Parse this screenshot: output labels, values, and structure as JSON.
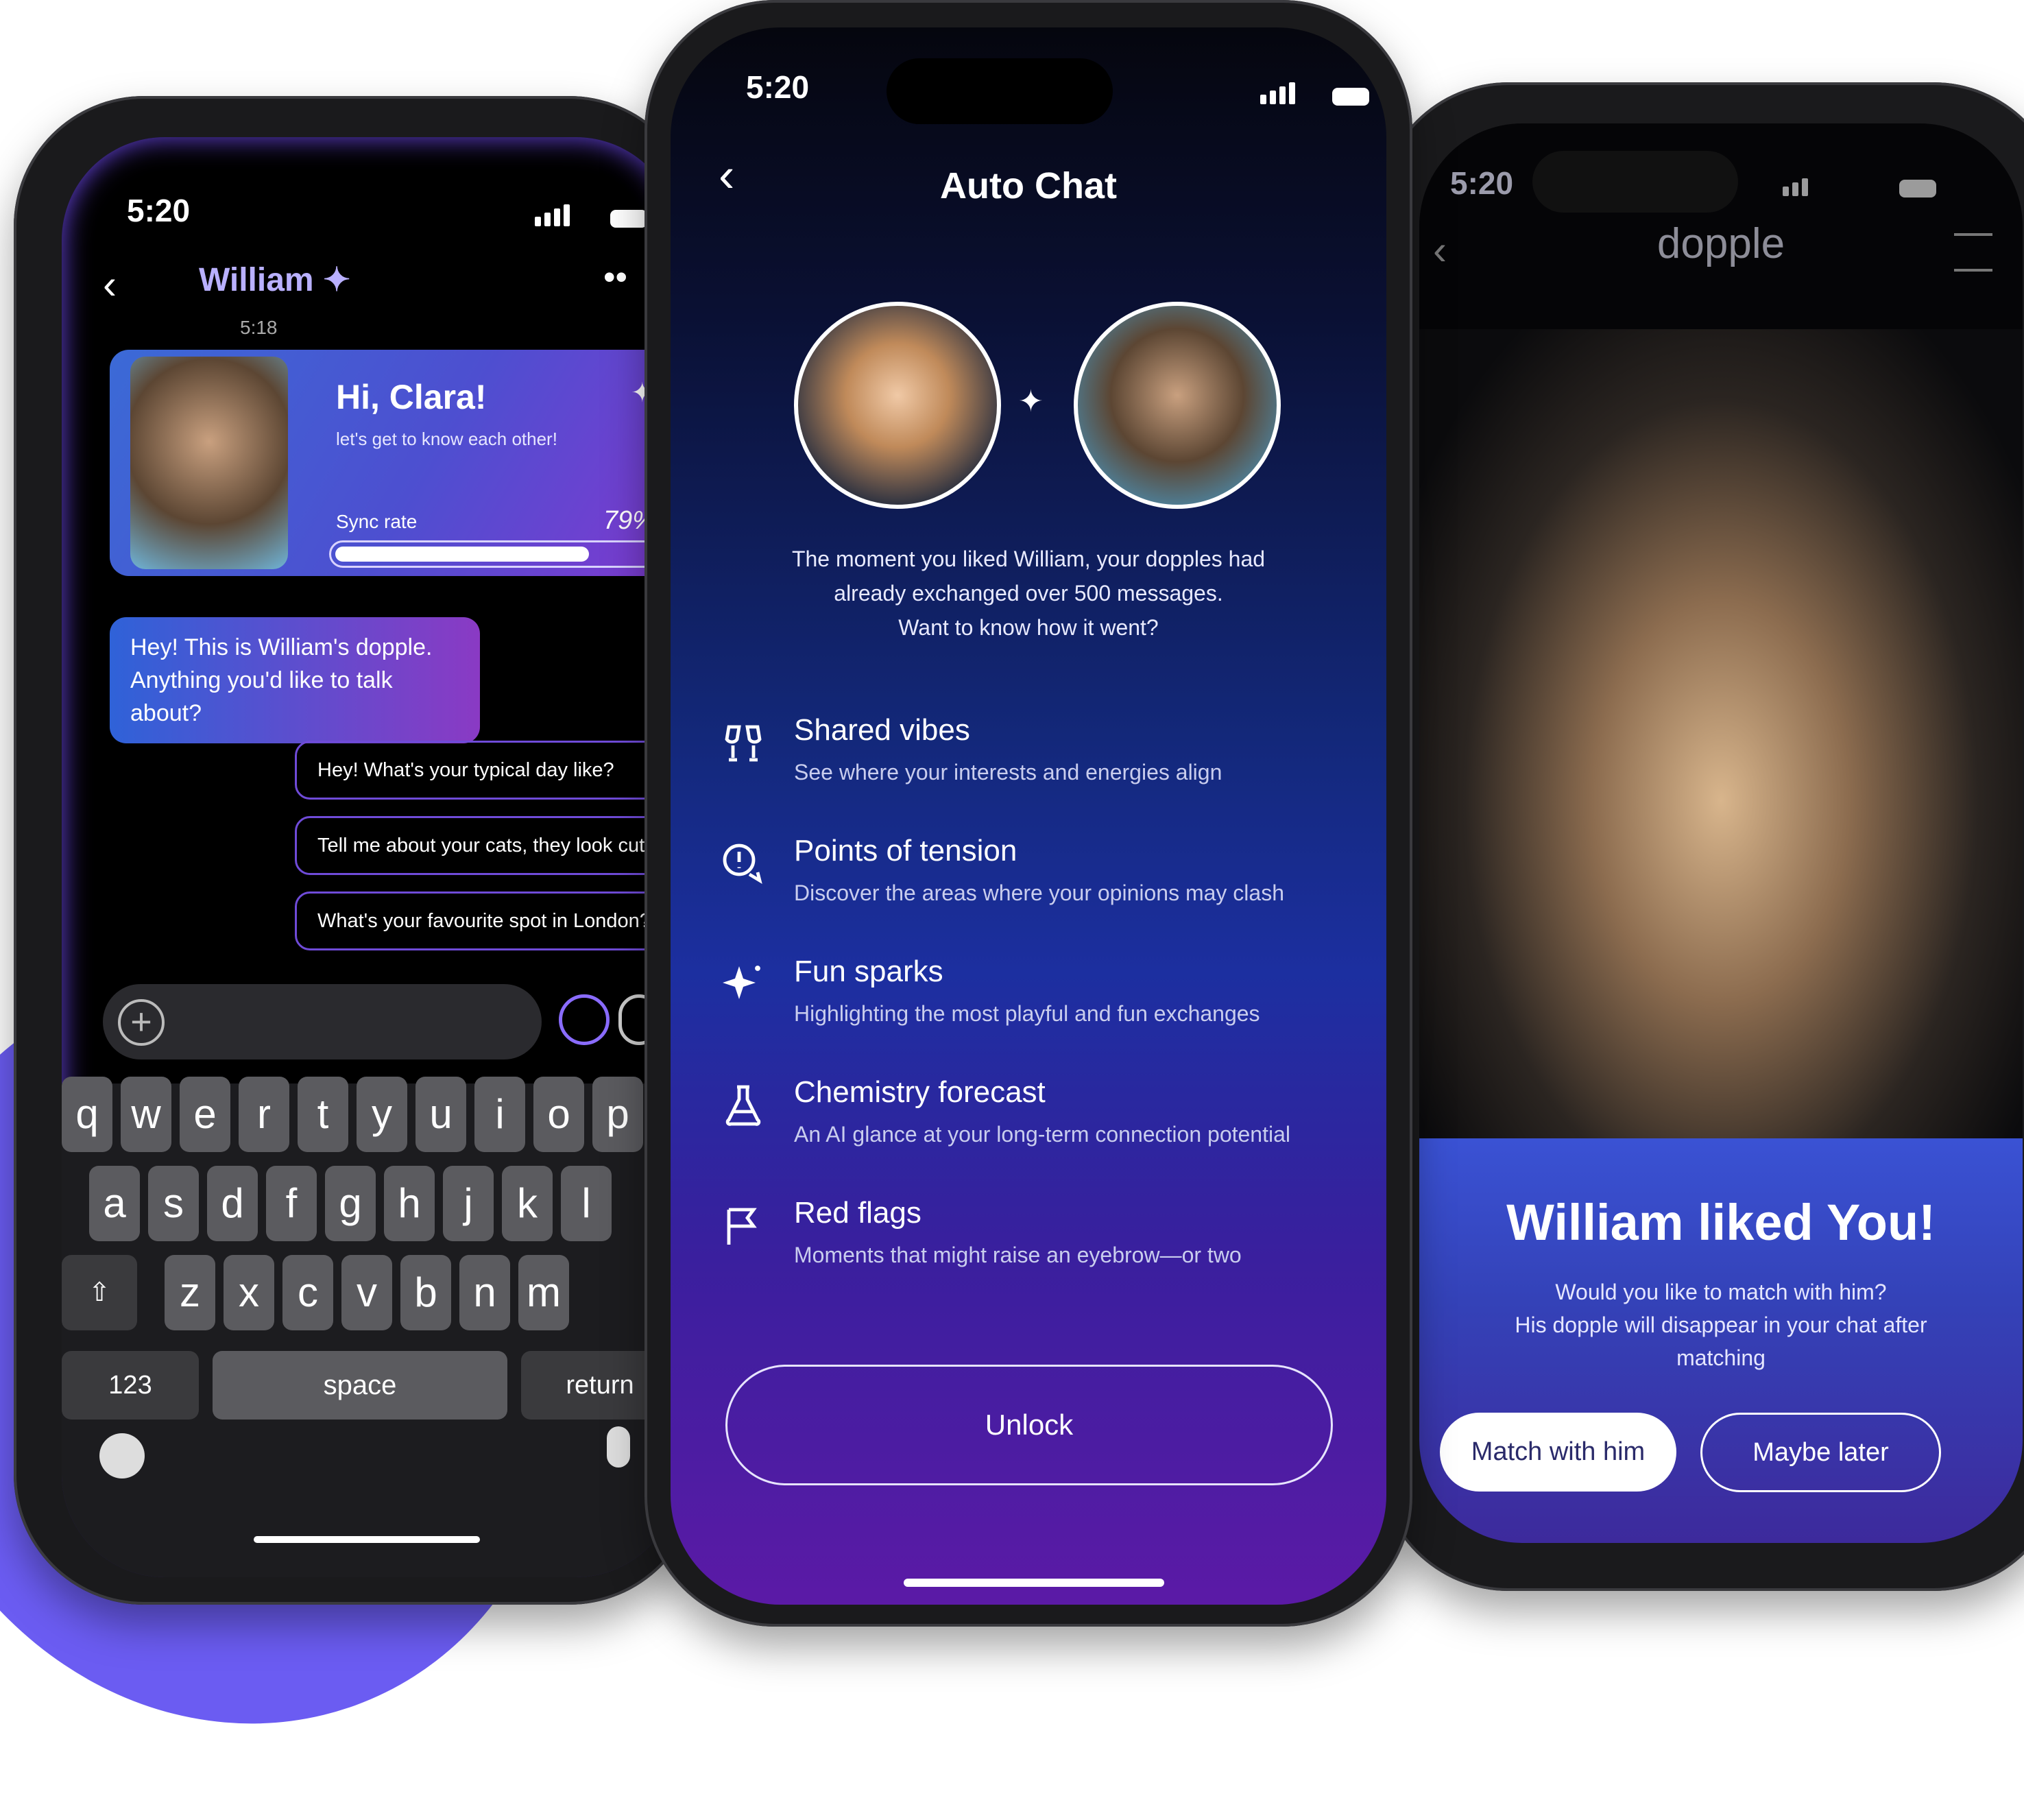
{
  "left": {
    "status_time": "5:20",
    "header_name": "William",
    "timestamp": "5:18",
    "card": {
      "greeting": "Hi, Clara!",
      "subtitle": "let's get to know each other!",
      "sync_label": "Sync rate",
      "sync_value": "79%",
      "sync_fraction": 0.79
    },
    "incoming_message": [
      "Hey! This is William's dopple.",
      "Anything you'd like to talk about?"
    ],
    "suggestions": [
      "Hey! What's your typical day like?",
      "Tell me about your cats, they look cute!",
      "What's your favourite spot in London?"
    ],
    "keyboard": {
      "row1": [
        "q",
        "w",
        "e",
        "r",
        "t",
        "y",
        "u",
        "i",
        "o",
        "p"
      ],
      "row2": [
        "a",
        "s",
        "d",
        "f",
        "g",
        "h",
        "j",
        "k",
        "l"
      ],
      "row3": [
        "z",
        "x",
        "c",
        "v",
        "b",
        "n",
        "m"
      ],
      "numbers_key": "123",
      "space_key": "space",
      "return_key": "return"
    }
  },
  "mid": {
    "status_time": "5:20",
    "title": "Auto Chat",
    "intro": [
      "The moment you liked William, your dopples had",
      "already exchanged over 500 messages.",
      "Want to know how it went?"
    ],
    "features": [
      {
        "icon": "glasses-cheers-icon",
        "title": "Shared vibes",
        "subtitle": "See where your interests and energies align"
      },
      {
        "icon": "speech-alert-icon",
        "title": "Points of tension",
        "subtitle": "Discover the areas where your opinions may clash"
      },
      {
        "icon": "sparkle-icon",
        "title": "Fun sparks",
        "subtitle": "Highlighting the most playful and fun exchanges"
      },
      {
        "icon": "flask-icon",
        "title": "Chemistry forecast",
        "subtitle": "An AI glance at your long-term connection potential"
      },
      {
        "icon": "flag-icon",
        "title": "Red flags",
        "subtitle": "Moments that might raise an eyebrow—or two"
      }
    ],
    "unlock_label": "Unlock"
  },
  "right": {
    "status_time": "5:20",
    "brand": "dopple",
    "headline": "William liked You!",
    "body": [
      "Would you like to match with him?",
      "His dopple will disappear in your chat after",
      "matching"
    ],
    "primary_button": "Match with him",
    "secondary_button": "Maybe later"
  }
}
